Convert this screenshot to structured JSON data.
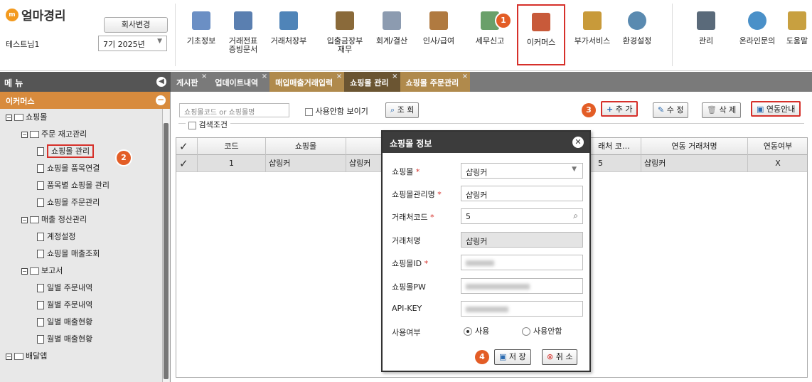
{
  "app": {
    "title": "얼마경리",
    "logo_glyph": "m",
    "user": "테스트님1",
    "company_btn": "회사변경",
    "period": "7기 2025년"
  },
  "toolbar": [
    {
      "label": "기초정보",
      "icon": "basic-info-icon",
      "color": "#6b8fc4"
    },
    {
      "label": "거래전표\n증빙문서",
      "icon": "voucher-icon",
      "color": "#5a7fb0"
    },
    {
      "label": "거래처장부",
      "icon": "ledger-icon",
      "color": "#4f84b8"
    },
    {
      "label": "입출금장부\n재무",
      "icon": "money-bag-icon",
      "color": "#8a6a3a"
    },
    {
      "label": "회계/결산",
      "icon": "calculator-icon",
      "color": "#8c9bb0"
    },
    {
      "label": "인사/급여",
      "icon": "person-icon",
      "color": "#b07a40"
    },
    {
      "label": "세무신고",
      "icon": "tax-icon",
      "color": "#6aa06a"
    },
    {
      "label": "이커머스",
      "icon": "shop-icon",
      "color": "#c85a3a"
    },
    {
      "label": "부가서비스",
      "icon": "bank-icon",
      "color": "#c89a3a"
    },
    {
      "label": "환경설정",
      "icon": "gear-icon",
      "color": "#5a8ab0"
    },
    {
      "label": "관리",
      "icon": "puzzle-icon",
      "color": "#5a6a7a"
    },
    {
      "label": "온라인문의",
      "icon": "support-icon",
      "color": "#4a90c8"
    },
    {
      "label": "도움말",
      "icon": "help-book-icon",
      "color": "#c8a040"
    }
  ],
  "badges": [
    "1",
    "2",
    "3",
    "4"
  ],
  "menu_header": "메 뉴",
  "tabs": [
    "게시판",
    "업데이트내역",
    "매입매출거래입력",
    "쇼핑몰 관리",
    "쇼핑몰 주문관리"
  ],
  "sidebar": {
    "title": "이커머스",
    "items": [
      {
        "label": "쇼핑몰",
        "level": 0,
        "type": "folder"
      },
      {
        "label": "주문 재고관리",
        "level": 1,
        "type": "folder"
      },
      {
        "label": "쇼핑몰 관리",
        "level": 2,
        "type": "page",
        "selected": true
      },
      {
        "label": "쇼핑몰 품목연결",
        "level": 2,
        "type": "page"
      },
      {
        "label": "품목별 쇼핑몰 관리",
        "level": 2,
        "type": "page"
      },
      {
        "label": "쇼핑몰 주문관리",
        "level": 2,
        "type": "page"
      },
      {
        "label": "매출 정산관리",
        "level": 1,
        "type": "folder"
      },
      {
        "label": "계정설정",
        "level": 2,
        "type": "page"
      },
      {
        "label": "쇼핑몰 매출조회",
        "level": 2,
        "type": "page"
      },
      {
        "label": "보고서",
        "level": 1,
        "type": "folder"
      },
      {
        "label": "일별 주문내역",
        "level": 2,
        "type": "page"
      },
      {
        "label": "월별 주문내역",
        "level": 2,
        "type": "page"
      },
      {
        "label": "일별 매출현황",
        "level": 2,
        "type": "page"
      },
      {
        "label": "월별 매출현황",
        "level": 2,
        "type": "page"
      },
      {
        "label": "배달앱",
        "level": 0,
        "type": "folder"
      }
    ]
  },
  "search": {
    "placeholder": "쇼핑몰코드 or 쇼핑몰명",
    "show_unused": "사용안함 보이기",
    "query_btn": "조 회"
  },
  "actions": {
    "add": "추 가",
    "edit": "수 정",
    "delete": "삭 제",
    "guide": "연동안내"
  },
  "filter_label": "검색조건",
  "grid": {
    "columns": [
      "코드",
      "쇼핑몰",
      "래처 코…",
      "연동 거래처명",
      "연동여부"
    ],
    "row": [
      "1",
      "샵링커",
      "샵링커",
      "5",
      "샵링커",
      "X"
    ]
  },
  "dialog": {
    "title": "쇼핑몰 정보",
    "fields": [
      {
        "label": "쇼핑몰",
        "required": true,
        "value": "샵링커",
        "kind": "select"
      },
      {
        "label": "쇼핑몰관리명",
        "required": true,
        "value": "샵링커",
        "kind": "text"
      },
      {
        "label": "거래처코드",
        "required": true,
        "value": "5",
        "kind": "search"
      },
      {
        "label": "거래처명",
        "required": false,
        "value": "샵링커",
        "kind": "readonly"
      },
      {
        "label": "쇼핑몰ID",
        "required": true,
        "value": "",
        "kind": "masked"
      },
      {
        "label": "쇼핑몰PW",
        "required": false,
        "value": "",
        "kind": "masked"
      },
      {
        "label": "API-KEY",
        "required": false,
        "value": "",
        "kind": "masked"
      }
    ],
    "use_label": "사용여부",
    "use_options": [
      "사용",
      "사용안함"
    ],
    "save": "저 장",
    "cancel": "취 소"
  },
  "colors": {
    "highlight": "#d6302a",
    "badge": "#e35d26",
    "sidebar_title": "#d88b3d",
    "tab_active": "#6b5532"
  }
}
